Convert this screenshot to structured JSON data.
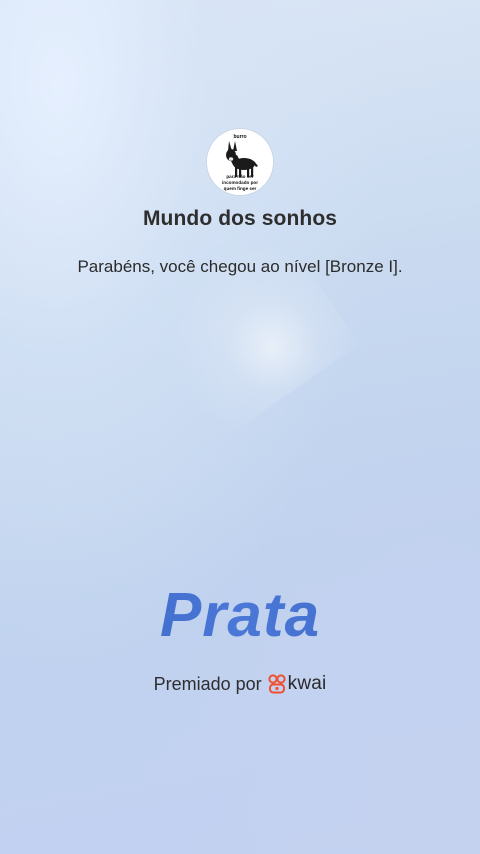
{
  "profile": {
    "avatar_caption_top": "burro",
    "avatar_caption_bottom_1": "para não ser",
    "avatar_caption_bottom_2": "incomodado por",
    "avatar_caption_bottom_3": "quem finge ser",
    "name": "Mundo dos sonhos"
  },
  "message": "Parabéns, você chegou ao nível [Bronze I].",
  "tier": "Prata",
  "awarded_by": {
    "label": "Premiado por",
    "brand": "kwai"
  },
  "colors": {
    "tier_blue": "#3f69c8",
    "brand_red": "#f0502f"
  }
}
